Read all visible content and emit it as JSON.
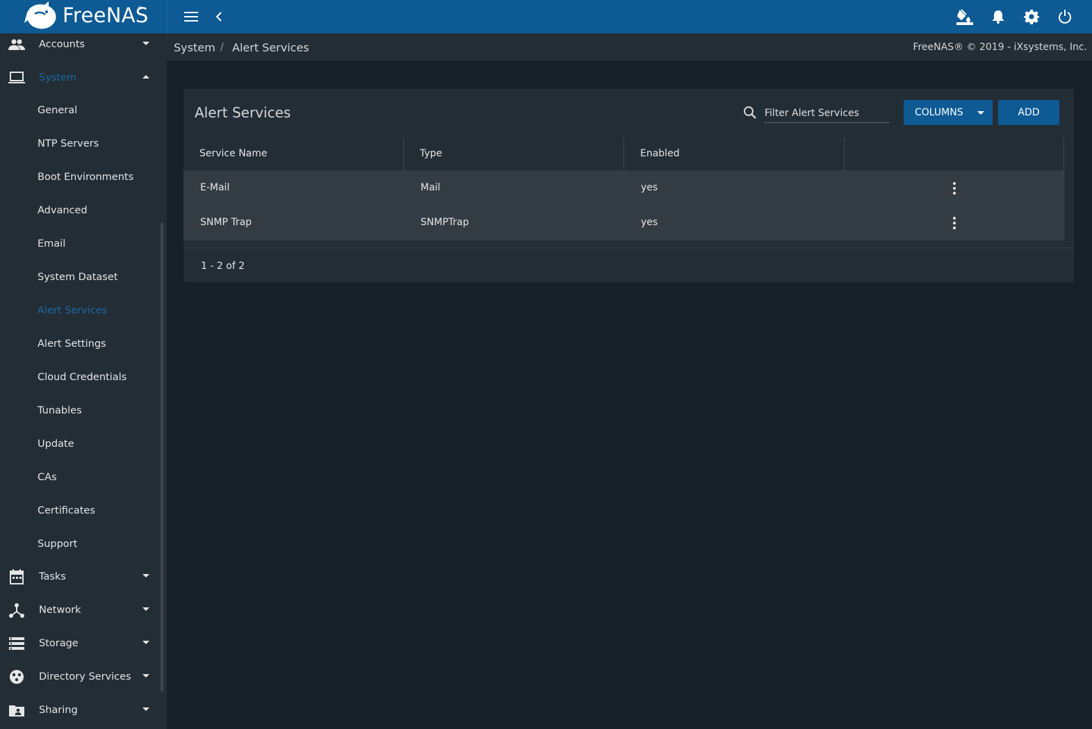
{
  "app": {
    "brand": "FreeNAS",
    "trademark": "®"
  },
  "topbar": {
    "icons": [
      "menu-icon",
      "back-chevron-icon",
      "theme-paint-icon",
      "notifications-bell-icon",
      "settings-gear-icon",
      "power-icon"
    ]
  },
  "sidebar": {
    "items": [
      {
        "label": "Accounts",
        "icon": "accounts-people-icon",
        "expanded": false
      },
      {
        "label": "System",
        "icon": "laptop-icon",
        "expanded": true
      },
      {
        "label": "Tasks",
        "icon": "calendar-icon",
        "expanded": false
      },
      {
        "label": "Network",
        "icon": "network-hub-icon",
        "expanded": false
      },
      {
        "label": "Storage",
        "icon": "storage-stack-icon",
        "expanded": false
      },
      {
        "label": "Directory Services",
        "icon": "directory-services-icon",
        "expanded": false
      },
      {
        "label": "Sharing",
        "icon": "shared-folder-icon",
        "expanded": false
      }
    ],
    "system_subitems": [
      "General",
      "NTP Servers",
      "Boot Environments",
      "Advanced",
      "Email",
      "System Dataset",
      "Alert Services",
      "Alert Settings",
      "Cloud Credentials",
      "Tunables",
      "Update",
      "CAs",
      "Certificates",
      "Support"
    ],
    "active_subitem": "Alert Services"
  },
  "breadcrumb": {
    "parent": "System",
    "separator": "/",
    "current": "Alert Services"
  },
  "copyright": "FreeNAS® © 2019 - iXsystems, Inc.",
  "card": {
    "title": "Alert Services",
    "filter_placeholder": "Filter Alert Services",
    "columns_button": "COLUMNS",
    "add_button": "ADD",
    "columns": [
      "Service Name",
      "Type",
      "Enabled"
    ],
    "rows": [
      {
        "name": "E-Mail",
        "type": "Mail",
        "enabled": "yes"
      },
      {
        "name": "SNMP Trap",
        "type": "SNMPTrap",
        "enabled": "yes"
      }
    ],
    "pagination": "1 - 2 of 2"
  },
  "colors": {
    "topbar": "#0d5a94",
    "sidebar": "#232d35",
    "background": "#171f27",
    "accent": "#1b6aa5"
  }
}
